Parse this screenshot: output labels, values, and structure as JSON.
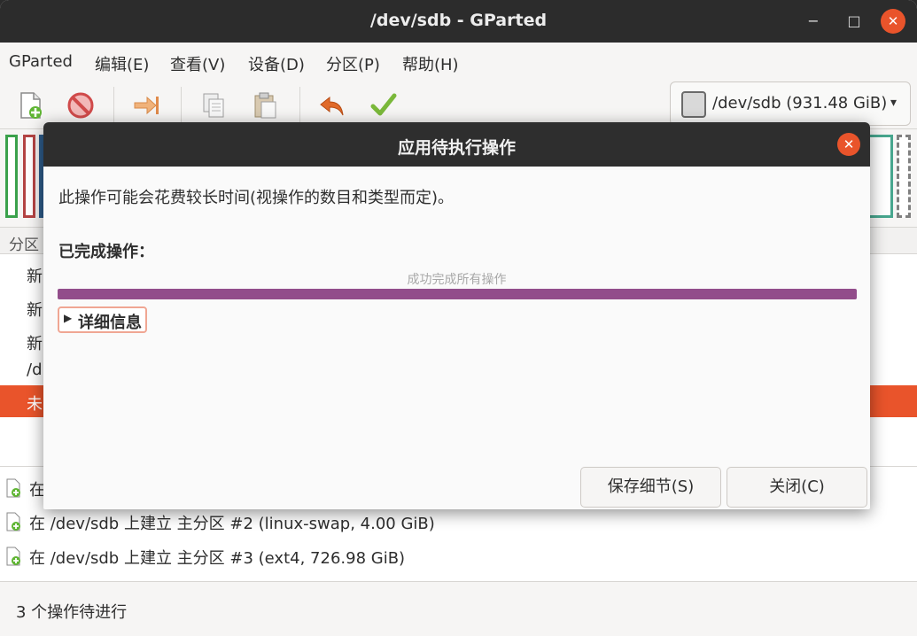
{
  "window": {
    "title": "/dev/sdb - GParted",
    "minimize_glyph": "−",
    "maximize_glyph": "□",
    "close_glyph": "✕"
  },
  "menu": [
    "GParted",
    "编辑(E)",
    "查看(V)",
    "设备(D)",
    "分区(P)",
    "帮助(H)"
  ],
  "toolbar": {
    "icons": [
      "new-partition-icon",
      "delete-icon",
      "resize-move-icon",
      "copy-icon",
      "paste-icon",
      "undo-icon",
      "apply-icon"
    ]
  },
  "device_selector": {
    "label": "/dev/sdb (931.48 GiB)",
    "caret": "▾"
  },
  "partition_list": {
    "header_partial": "分区",
    "rows_partial": [
      "新",
      "新",
      "新",
      "/d",
      "未"
    ]
  },
  "pending_operations": [
    "在",
    "在 /dev/sdb 上建立 主分区 #2 (linux-swap, 4.00 GiB)",
    "在 /dev/sdb 上建立 主分区 #3 (ext4, 726.98 GiB)"
  ],
  "status": {
    "text": "3 个操作待进行"
  },
  "dialog": {
    "title": "应用待执行操作",
    "close_glyph": "✕",
    "message": "此操作可能会花费较长时间(视操作的数目和类型而定)。",
    "completed_label": "已完成操作：",
    "progress_text": "成功完成所有操作",
    "progress_fraction": 1.0,
    "details_arrow": "▶",
    "details_label": "详细信息",
    "save_button": "保存细节(S)",
    "close_button": "关闭(C)"
  },
  "colors": {
    "accent": "#e9542b",
    "progress": "#924d8b",
    "titlebar": "#2c2c2c"
  }
}
